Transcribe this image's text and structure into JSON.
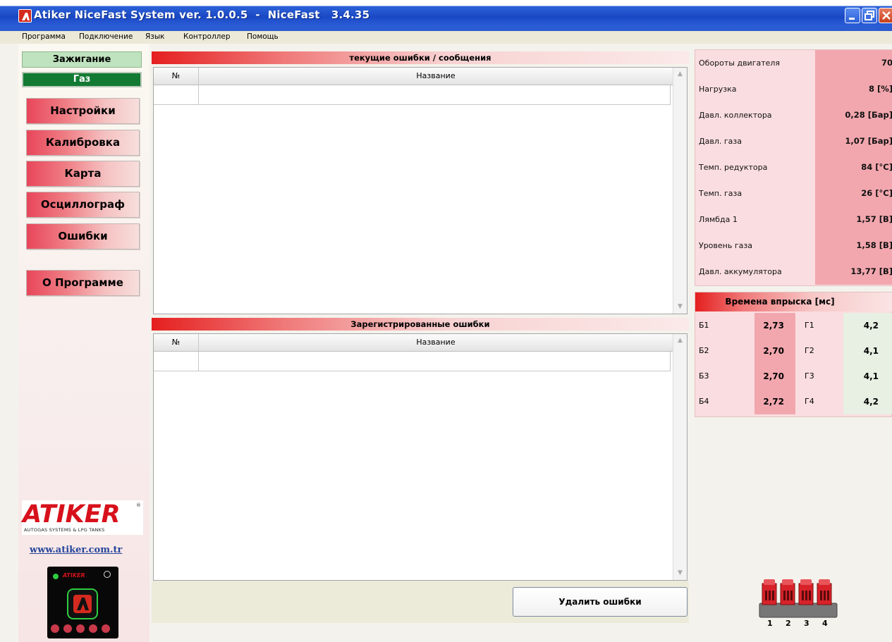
{
  "window": {
    "title": "Atiker NiceFast System ver. 1.0.0.5  -  NiceFast   3.4.35",
    "colors": {
      "titlebar": "#1a48c4",
      "accent_red": "#e51f1f",
      "gas_green": "#127a32"
    }
  },
  "menu": {
    "items": [
      "Программа",
      "Подключение",
      "Язык",
      "Контроллер",
      "Помощь"
    ]
  },
  "sidebar": {
    "status_ignition": "Зажигание",
    "status_gas": "Газ",
    "nav": [
      "Настройки",
      "Калибровка",
      "Карта",
      "Осциллограф",
      "Ошибки"
    ],
    "about": "О Программе",
    "logo": {
      "text": "ATIKER",
      "reg": "®",
      "tagline": "AUTOGAS SYSTEMS & LPG TANKS"
    },
    "website": "www.atiker.com.tr",
    "device_brand": "ATIKER"
  },
  "current_errors": {
    "title": "текущие ошибки / сообщения",
    "col_no": "№",
    "col_name": "Название"
  },
  "registered_errors": {
    "title": "Зарегистрированные ошибки",
    "col_no": "№",
    "col_name": "Название"
  },
  "actions": {
    "delete_errors": "Удалить ошибки"
  },
  "sensors": [
    {
      "label": "Обороты двигателя",
      "value": "70"
    },
    {
      "label": "Нагрузка",
      "value": "8 [%]"
    },
    {
      "label": "Давл. коллектора",
      "value": "0,28 [Бар]"
    },
    {
      "label": "Давл. газа",
      "value": "1,07 [Бар]"
    },
    {
      "label": "Темп. редуктора",
      "value": "84 [°C]"
    },
    {
      "label": "Темп. газа",
      "value": "26 [°C]"
    },
    {
      "label": "Лямбда 1",
      "value": "1,57 [B]"
    },
    {
      "label": "Уровень газа",
      "value": "1,58 [B]"
    },
    {
      "label": "Давл. аккумулятора",
      "value": "13,77 [B]"
    }
  ],
  "injection": {
    "title": "Времена впрыска [мс]",
    "rows": [
      {
        "b_label": "Б1",
        "b_value": "2,73",
        "g_label": "Г1",
        "g_value": "4,2"
      },
      {
        "b_label": "Б2",
        "b_value": "2,70",
        "g_label": "Г2",
        "g_value": "4,1"
      },
      {
        "b_label": "Б3",
        "b_value": "2,70",
        "g_label": "Г3",
        "g_value": "4,1"
      },
      {
        "b_label": "Б4",
        "b_value": "2,72",
        "g_label": "Г4",
        "g_value": "4,2"
      }
    ]
  },
  "injector_rail": {
    "numbers": [
      "1",
      "2",
      "3",
      "4"
    ]
  }
}
